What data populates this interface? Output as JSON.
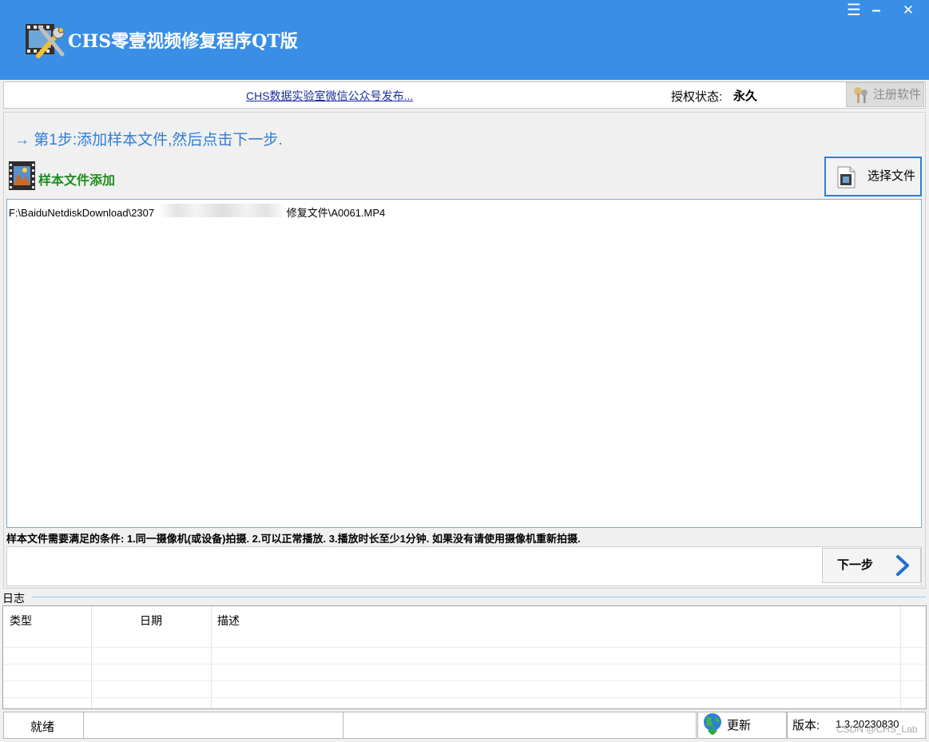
{
  "window": {
    "title": "CHS零壹视频修复程序QT版",
    "controls": {
      "menu": "☰",
      "minimize": "–",
      "close": "✕"
    }
  },
  "info_bar": {
    "announcement_link": "CHS数据实验室微信公众号发布...",
    "auth_label": "授权状态:",
    "auth_value": "永久",
    "register_button": "注册软件"
  },
  "step": {
    "arrow": "→",
    "instruction": "第1步:添加样本文件,然后点击下一步."
  },
  "sample": {
    "section_title": "样本文件添加",
    "choose_button": "选择文件",
    "file_path_prefix": "F:\\BaiduNetdiskDownload\\2307",
    "file_path_suffix": "\\待修复文件\\A0061.MP4",
    "conditions": "样本文件需要满足的条件: 1.同一摄像机(或设备)拍摄. 2.可以正常播放. 3.播放时长至少1分钟. 如果没有请使用摄像机重新拍摄."
  },
  "next_button": "下一步",
  "log": {
    "label": "日志",
    "columns": [
      "类型",
      "日期",
      "描述"
    ],
    "rows": []
  },
  "status_bar": {
    "status": "就绪",
    "update": "更新",
    "version_label": "版本:",
    "version_value": "1.3.20230830"
  },
  "watermark": "CSDN @CHS_Lab",
  "colors": {
    "title_bar": "#3a8ee6",
    "step_text": "#2f7ed8",
    "section_title": "#1e8c1e",
    "link": "#1a2b9e",
    "selected_border": "#2e7dd6"
  },
  "icons": {
    "app": "video-repair-tools-icon",
    "register": "keys-icon",
    "sample": "film-strip-icon",
    "choose": "video-file-icon",
    "next": "chevron-right-icon",
    "update": "globe-icon"
  }
}
